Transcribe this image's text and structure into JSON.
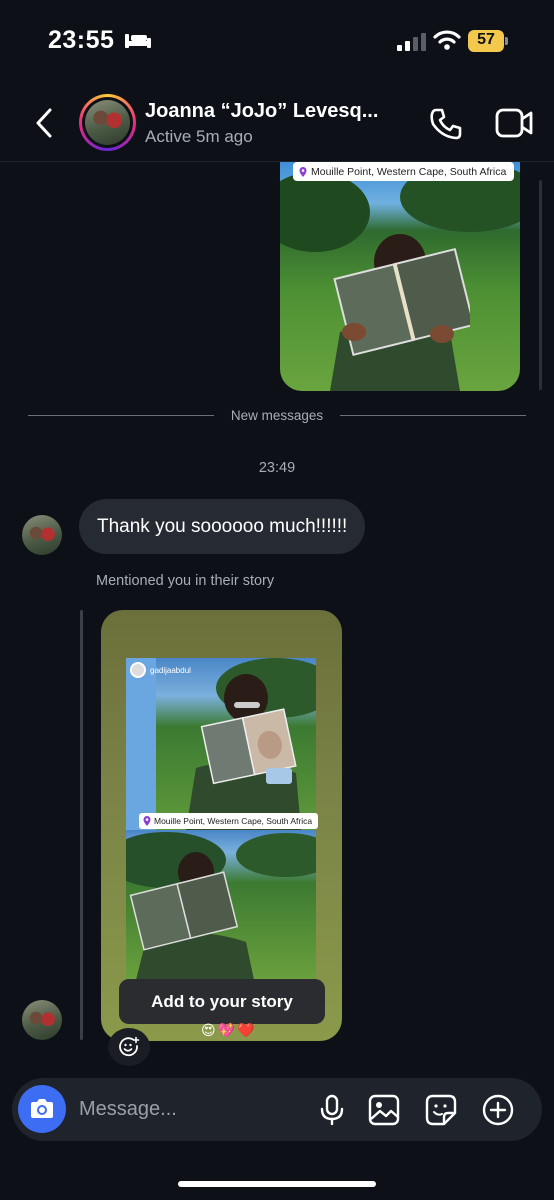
{
  "status_bar": {
    "time": "23:55",
    "battery_level": "57",
    "battery_color": "#f2c94c"
  },
  "header": {
    "contact_name": "Joanna “JoJo” Levesq...",
    "status": "Active 5m ago"
  },
  "shared_photo": {
    "location": "Mouille Point, Western Cape, South Africa"
  },
  "divider": {
    "label": "New messages"
  },
  "thread": {
    "timestamp": "23:49",
    "message_text": "Thank you soooooo much!!!!!!",
    "mention_note": "Mentioned you in their story"
  },
  "story": {
    "username": "gadijaabdul",
    "location": "Mouille Point, Western Cape, South Africa",
    "add_button": "Add to your story",
    "emojis": "😍💖❤️"
  },
  "composer": {
    "placeholder": "Message...",
    "icons": [
      "camera-icon",
      "microphone-icon",
      "gallery-icon",
      "sticker-icon",
      "plus-icon"
    ],
    "accent": "#3d6df2"
  }
}
